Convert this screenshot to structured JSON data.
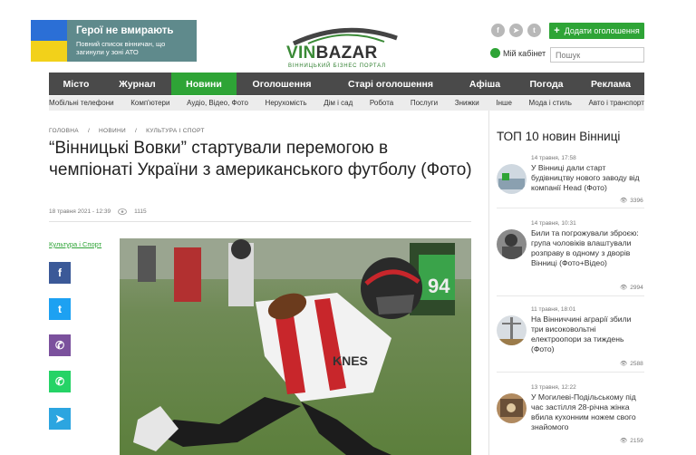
{
  "banner": {
    "title": "Герої не вмирають",
    "subtitle": "Повний список вінничан, що загинули у зоні АТО"
  },
  "logo": {
    "wordmark_a": "VIN",
    "wordmark_b": "BAZAR",
    "tagline": "ВІННИЦЬКИЙ БІЗНЕС ПОРТАЛ"
  },
  "header": {
    "socials": [
      {
        "icon": "facebook-icon",
        "glyph": "f"
      },
      {
        "icon": "telegram-icon",
        "glyph": "➤"
      },
      {
        "icon": "twitter-icon",
        "glyph": "t"
      }
    ],
    "add_ad_label": "Додати оголошення",
    "cabinet_label": "Мій кабінет",
    "search_placeholder": "Пошук"
  },
  "nav": {
    "items": [
      "Місто",
      "Журнал",
      "Новини",
      "Оголошення",
      "Старі оголошення",
      "Афіша",
      "Погода",
      "Реклама"
    ],
    "active_index": 2
  },
  "subnav": {
    "items": [
      "Мобільні телефони",
      "Комп'ютери",
      "Аудіо, Відео, Фото",
      "Нерухомість",
      "Дім і сад",
      "Робота",
      "Послуги",
      "Знижки",
      "Інше",
      "Мода і стиль",
      "Авто і транспорт"
    ]
  },
  "article": {
    "breadcrumbs": [
      "ГОЛОВНА",
      "/",
      "НОВИНИ",
      "/",
      "КУЛЬТУРА І СПОРТ"
    ],
    "title": "“Вінницькі Вовки” стартували перемогою в чемпіонаті України з американського футболу (Фото)",
    "date": "18 травня 2021 - 12:39",
    "views": "1115",
    "category": "Культура і Спорт",
    "share": [
      {
        "icon": "facebook-icon",
        "glyph": "f",
        "color": "#3b5998"
      },
      {
        "icon": "twitter-icon",
        "glyph": "t",
        "color": "#1da1f2"
      },
      {
        "icon": "viber-icon",
        "glyph": "✆",
        "color": "#7b519d"
      },
      {
        "icon": "whatsapp-icon",
        "glyph": "✆",
        "color": "#25d366"
      },
      {
        "icon": "telegram-icon",
        "glyph": "➤",
        "color": "#2ca5e0"
      }
    ]
  },
  "sidebar": {
    "title": "ТОП 10 новин Вінниці",
    "news": [
      {
        "date": "14 травня, 17:58",
        "headline": "У Вінниці дали старт будівництву нового заводу від компанії Head (Фото)",
        "views": "3396"
      },
      {
        "date": "14 травня, 10:31",
        "headline": "Били та погрожували зброєю: група чоловіків влаштували розправу в одному з дворів Вінниці (Фото+Відео)",
        "views": "2994"
      },
      {
        "date": "11 травня, 18:01",
        "headline": "На Вінниччині аграрії збили три високовольтні електроопори за тиждень (Фото)",
        "views": "2588"
      },
      {
        "date": "13 травня, 12:22",
        "headline": "У Могилеві-Подільському під час застілля 28-річна жінка вбила кухонним ножем свого знайомого",
        "views": "2159"
      }
    ]
  },
  "colors": {
    "brand_green": "#2ea436",
    "nav_dark": "#4a4a4a"
  }
}
